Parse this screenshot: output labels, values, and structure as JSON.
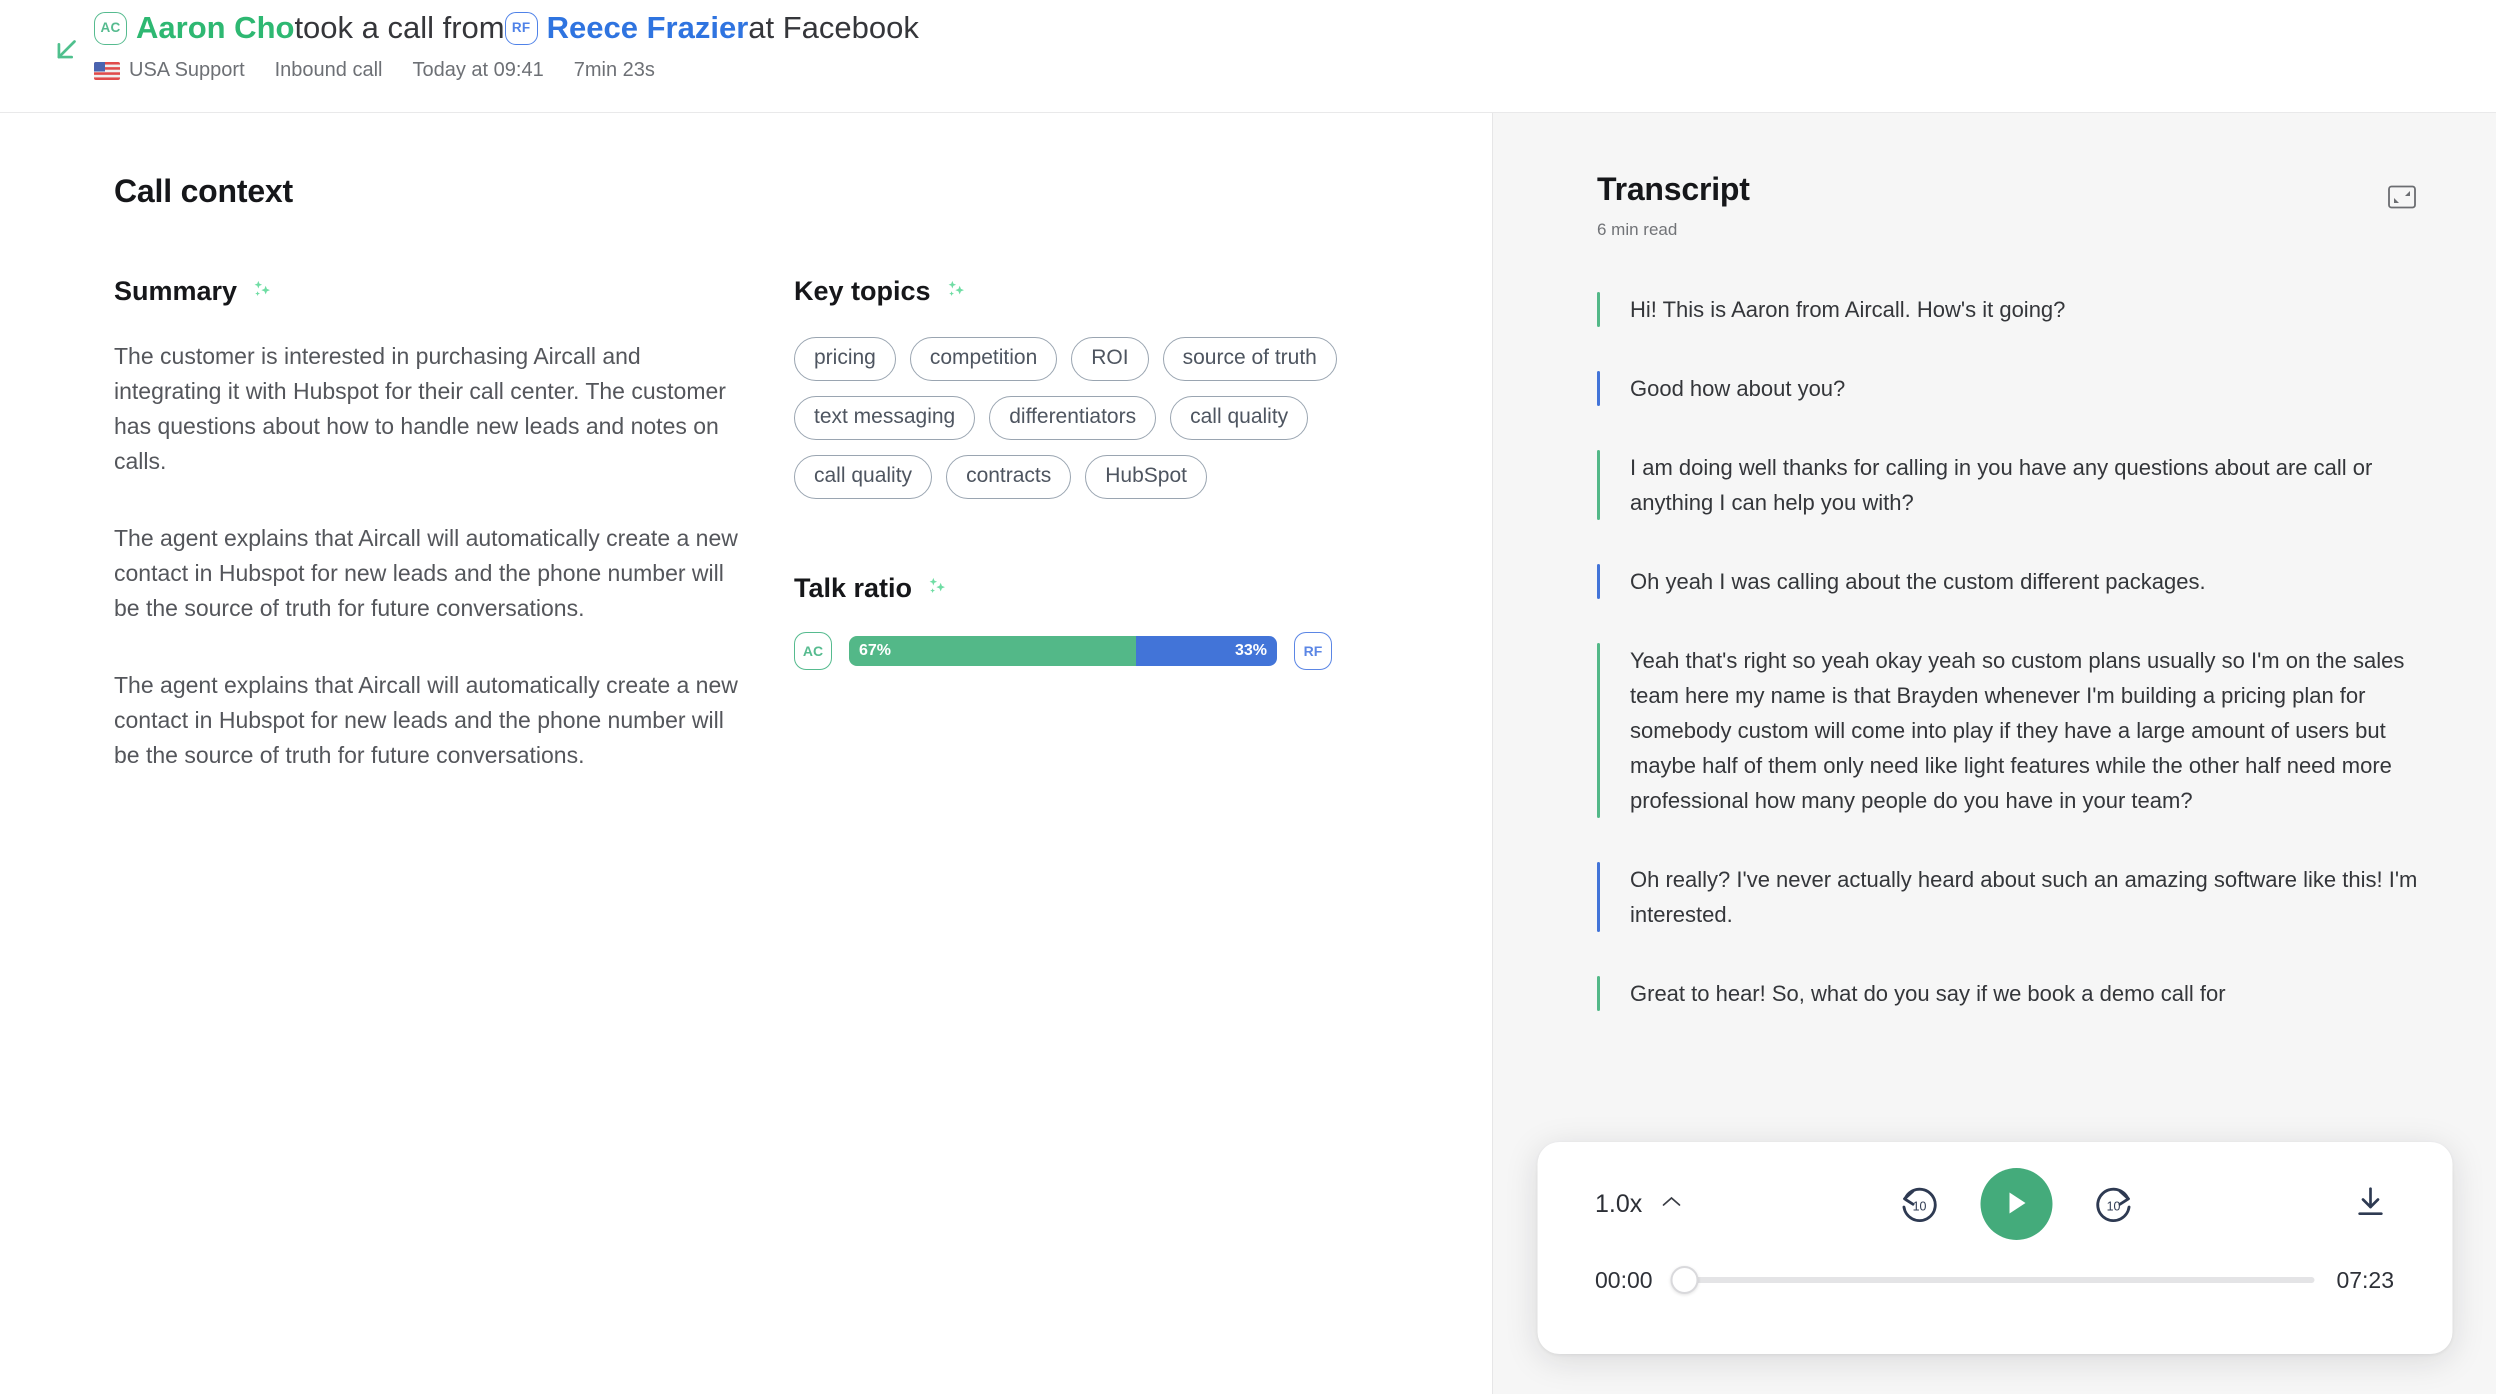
{
  "header": {
    "back_icon": "arrow-down-left-icon",
    "agent": {
      "initials": "AC",
      "name": "Aaron Cho"
    },
    "middle_text": " took a call from ",
    "customer": {
      "initials": "RF",
      "name": "Reece Frazier"
    },
    "company_text": " at Facebook",
    "meta": {
      "line_label": "USA Support",
      "direction": "Inbound call",
      "time": "Today at 09:41",
      "duration": "7min 23s",
      "flag_icon": "usa-flag-icon"
    }
  },
  "left": {
    "page_title": "Call context",
    "summary": {
      "heading": "Summary",
      "sparkle_icon": "ai-sparkle-icon",
      "paragraphs": [
        "The customer is interested in purchasing Aircall and integrating it with Hubspot for their call center. The customer has questions about how to handle new leads and notes on calls.",
        "The agent explains that Aircall will automatically create a new contact in Hubspot for new leads and the phone number will be the source of truth for future conversations.",
        "The agent explains that Aircall will automatically create a new contact in Hubspot for new leads and the phone number will be the source of truth for future conversations."
      ]
    },
    "key_topics": {
      "heading": "Key topics",
      "sparkle_icon": "ai-sparkle-icon",
      "tags": [
        "pricing",
        "competition",
        "ROI",
        "source of truth",
        "text messaging",
        "differentiators",
        "call quality",
        "call quality",
        "contracts",
        "HubSpot"
      ]
    },
    "talk_ratio": {
      "heading": "Talk ratio",
      "sparkle_icon": "ai-sparkle-icon",
      "left_initials": "AC",
      "right_initials": "RF",
      "left_percent": "67%",
      "right_percent": "33%",
      "left_value": 67,
      "right_value": 33,
      "left_color": "#53b888",
      "right_color": "#4274d8"
    }
  },
  "transcript": {
    "title": "Transcript",
    "read_time": "6 min read",
    "expand_icon": "collapse-panel-icon",
    "messages": [
      {
        "speaker": "agent",
        "text": "Hi! This is Aaron from Aircall. How's it going?"
      },
      {
        "speaker": "customer",
        "text": "Good how about you?"
      },
      {
        "speaker": "agent",
        "text": "I am doing well thanks for calling in you have any questions about are call or anything I can help you with?"
      },
      {
        "speaker": "customer",
        "text": "Oh yeah I was calling about the custom different packages."
      },
      {
        "speaker": "agent",
        "text": "Yeah that's right so yeah okay yeah so custom plans usually so I'm on the sales team here my name is that Brayden whenever I'm building a pricing plan for somebody custom will come into play if they have a large amount of users but maybe half of them only need like light features while the other half need more professional how many people do you have in your team?"
      },
      {
        "speaker": "customer",
        "text": "Oh really? I've never actually heard about such an amazing software like this! I'm interested."
      },
      {
        "speaker": "agent",
        "text": "Great to hear! So, what do you say if we book a demo call for"
      }
    ]
  },
  "player": {
    "speed_label": "1.0x",
    "speed_chevron_icon": "chevron-up-icon",
    "rewind_icon": "rewind-10-icon",
    "rewind_label": "10",
    "play_icon": "play-icon",
    "forward_icon": "forward-10-icon",
    "forward_label": "10",
    "download_icon": "download-icon",
    "current_time": "00:00",
    "total_time": "07:23",
    "progress_percent": 0,
    "accent_color": "#44ab7b"
  }
}
